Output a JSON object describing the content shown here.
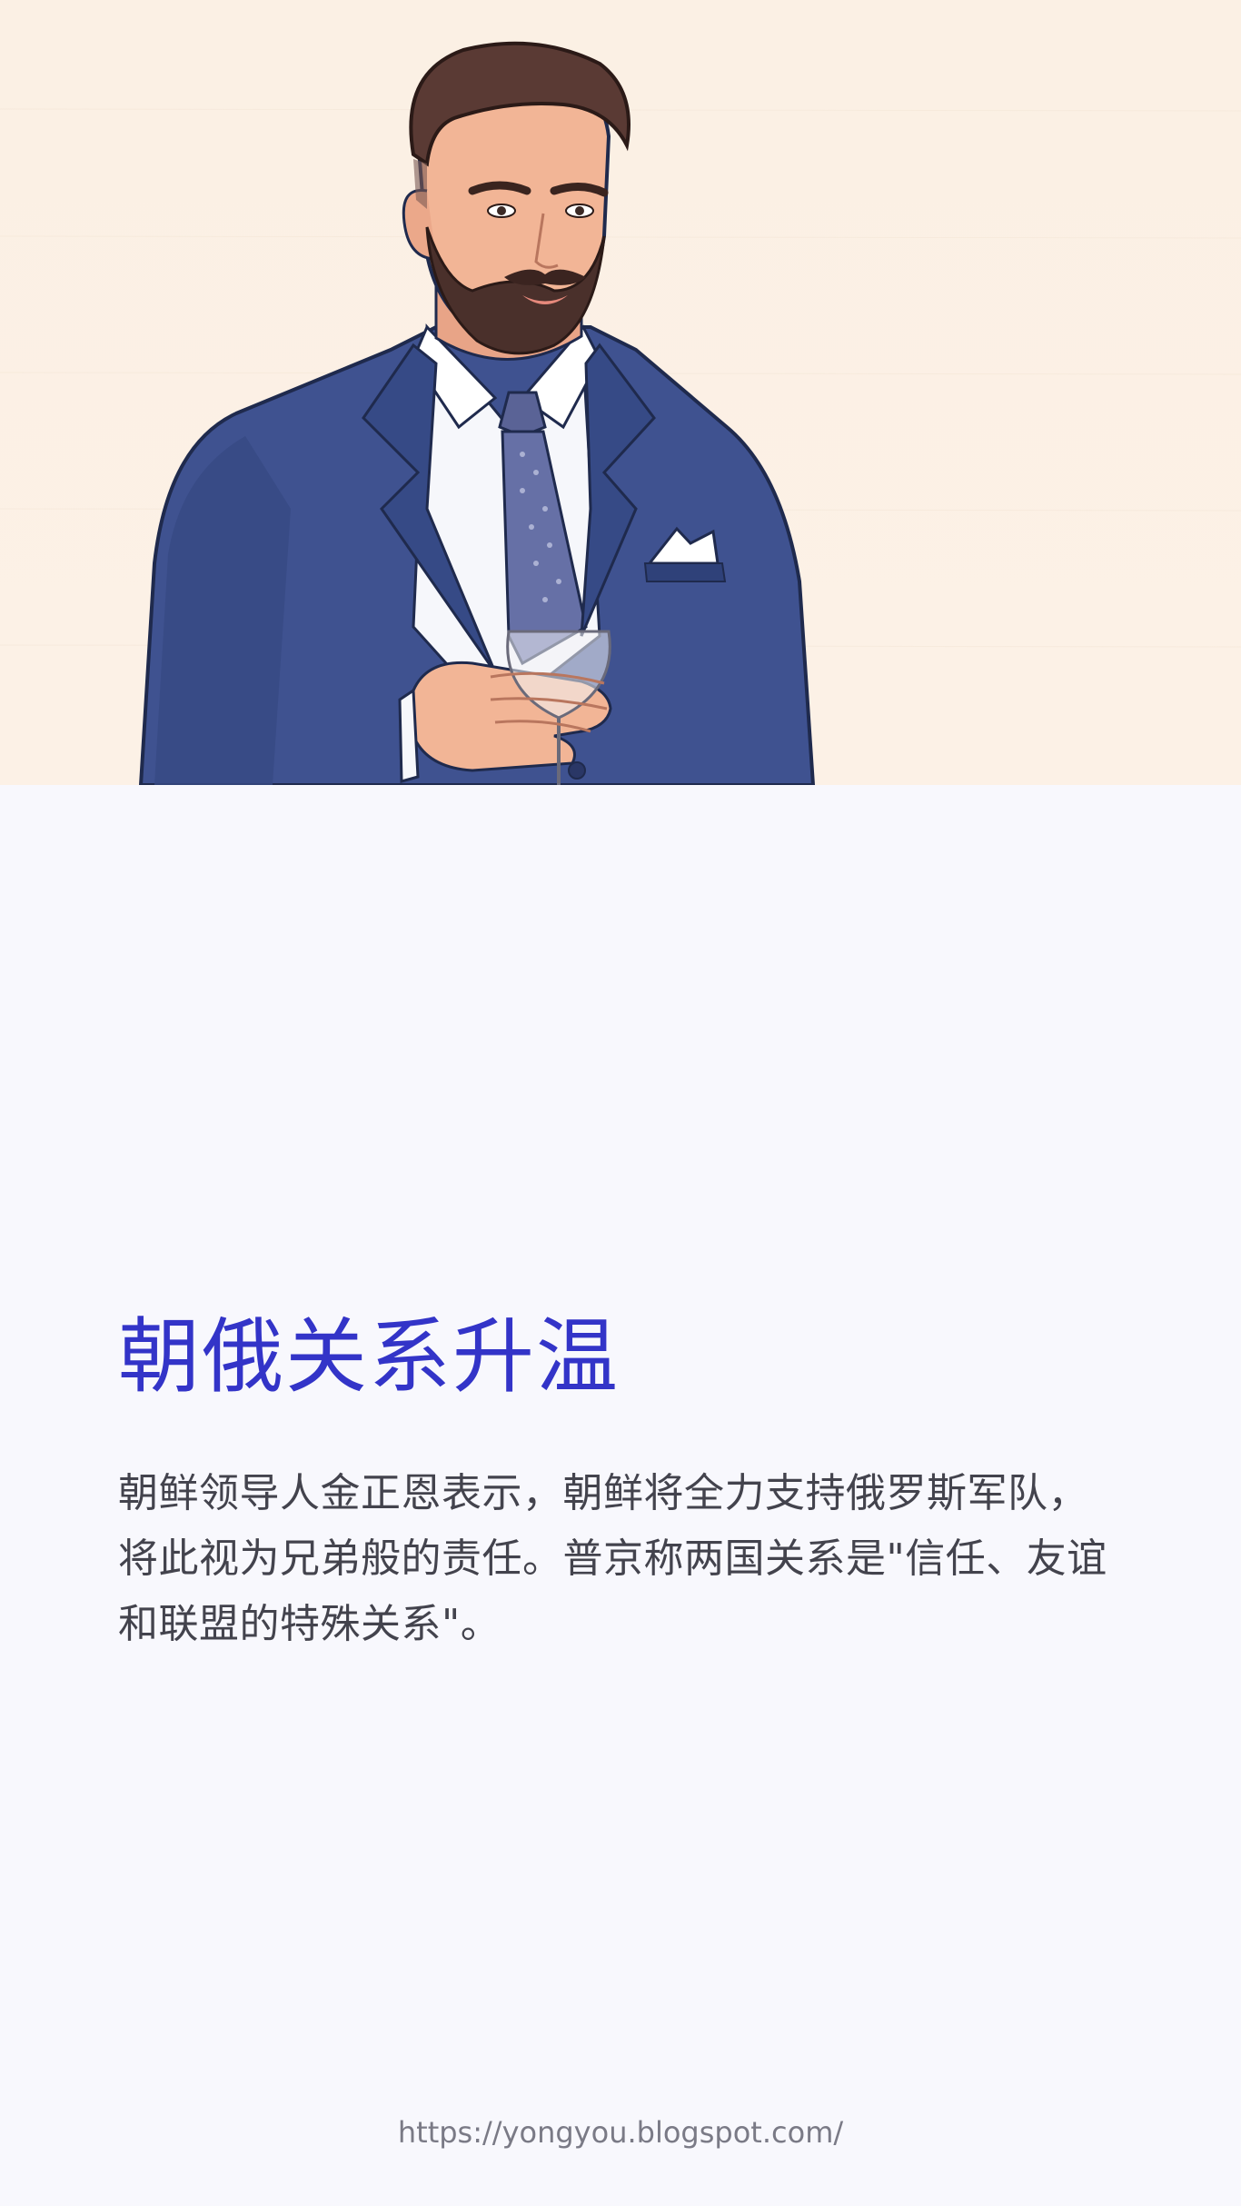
{
  "article": {
    "title": "朝俄关系升温",
    "body": "朝鲜领导人金正恩表示，朝鲜将全力支持俄罗斯军队，将此视为兄弟般的责任。普京称两国关系是\"信任、友谊和联盟的特殊关系\"。"
  },
  "footer": {
    "url": "https://yongyou.blogspot.com/"
  },
  "colors": {
    "title": "#3334c8",
    "body_text": "#43434d",
    "hero_background": "#fbf0e4",
    "page_background": "#f8f8fd",
    "suit": "#3f5290"
  },
  "hero": {
    "illustration": "bearded man in blue suit holding wine glass"
  }
}
